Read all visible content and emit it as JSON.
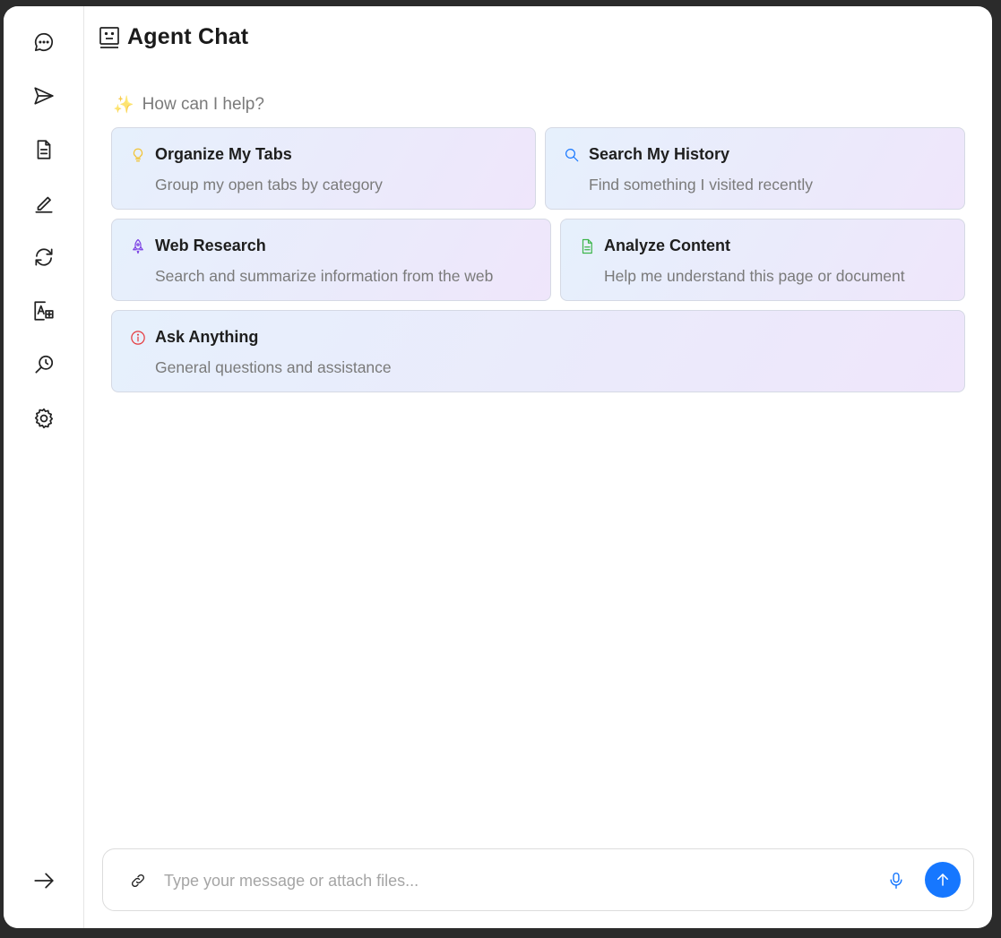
{
  "header": {
    "title": "Agent Chat",
    "icon": "robot-icon"
  },
  "sidebar": {
    "items": [
      {
        "name": "chat",
        "icon": "chat-bubble-icon"
      },
      {
        "name": "send",
        "icon": "send-icon"
      },
      {
        "name": "document",
        "icon": "document-icon"
      },
      {
        "name": "edit",
        "icon": "pencil-icon"
      },
      {
        "name": "sync",
        "icon": "refresh-icon"
      },
      {
        "name": "translate",
        "icon": "translate-icon"
      },
      {
        "name": "search-history",
        "icon": "search-history-icon"
      },
      {
        "name": "settings",
        "icon": "gear-icon"
      }
    ],
    "collapse_icon": "arrow-right-icon"
  },
  "welcome": {
    "prompt": "How can I help?",
    "icon": "sparkles-icon"
  },
  "cards": [
    {
      "title": "Organize My Tabs",
      "description": "Group my open tabs by category",
      "icon": "lightbulb-icon",
      "icon_color": "#f2c230"
    },
    {
      "title": "Search My History",
      "description": "Find something I visited recently",
      "icon": "search-icon",
      "icon_color": "#1677ff"
    },
    {
      "title": "Web Research",
      "description": "Search and summarize information from the web",
      "icon": "rocket-icon",
      "icon_color": "#7b3fe4"
    },
    {
      "title": "Analyze Content",
      "description": "Help me understand this page or document",
      "icon": "file-text-icon",
      "icon_color": "#3cb54a"
    },
    {
      "title": "Ask Anything",
      "description": "General questions and assistance",
      "icon": "info-circle-icon",
      "icon_color": "#e5383b"
    }
  ],
  "composer": {
    "placeholder": "Type your message or attach files...",
    "value": "",
    "attach_icon": "link-icon",
    "mic_icon": "microphone-icon",
    "send_icon": "arrow-up-icon",
    "accent": "#1677ff"
  }
}
